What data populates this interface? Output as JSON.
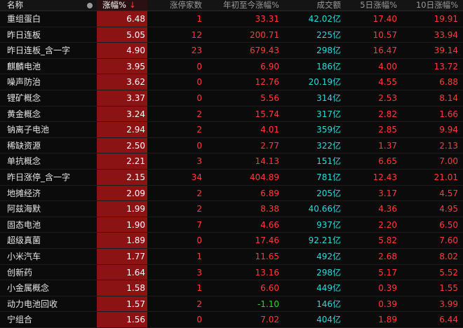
{
  "header": {
    "name": "名称",
    "pct": "涨幅%",
    "pct_sort_arrow": "↓",
    "limit_count": "涨停家数",
    "ytd": "年初至今涨幅%",
    "amount": "成交额",
    "d5": "5日涨幅%",
    "d10": "10日涨幅%"
  },
  "colors": {
    "up": "#ff3b3b",
    "down": "#2fd12f",
    "amount": "#33d6d6",
    "pct_bg": "#8b1313"
  },
  "rows": [
    {
      "name": "重组蛋白",
      "pct": "6.48",
      "limit": "1",
      "ytd": "33.31",
      "amount": "42.02亿",
      "d5": "17.40",
      "d10": "19.91"
    },
    {
      "name": "昨日连板",
      "pct": "5.05",
      "limit": "12",
      "ytd": "200.71",
      "amount": "225亿",
      "d5": "10.57",
      "d10": "33.94"
    },
    {
      "name": "昨日连板_含一字",
      "pct": "4.90",
      "limit": "23",
      "ytd": "679.43",
      "amount": "298亿",
      "d5": "16.47",
      "d10": "39.14"
    },
    {
      "name": "麒麟电池",
      "pct": "3.95",
      "limit": "0",
      "ytd": "6.90",
      "amount": "186亿",
      "d5": "4.00",
      "d10": "13.72"
    },
    {
      "name": "噪声防治",
      "pct": "3.62",
      "limit": "0",
      "ytd": "12.76",
      "amount": "20.19亿",
      "d5": "4.55",
      "d10": "6.88"
    },
    {
      "name": "锂矿概念",
      "pct": "3.37",
      "limit": "0",
      "ytd": "5.56",
      "amount": "314亿",
      "d5": "2.53",
      "d10": "8.14"
    },
    {
      "name": "黄金概念",
      "pct": "3.24",
      "limit": "2",
      "ytd": "15.74",
      "amount": "317亿",
      "d5": "2.82",
      "d10": "1.66"
    },
    {
      "name": "钠离子电池",
      "pct": "2.94",
      "limit": "2",
      "ytd": "4.01",
      "amount": "359亿",
      "d5": "2.85",
      "d10": "9.94"
    },
    {
      "name": "稀缺资源",
      "pct": "2.50",
      "limit": "0",
      "ytd": "2.77",
      "amount": "322亿",
      "d5": "1.37",
      "d10": "2.13"
    },
    {
      "name": "单抗概念",
      "pct": "2.21",
      "limit": "3",
      "ytd": "14.13",
      "amount": "151亿",
      "d5": "6.65",
      "d10": "7.00"
    },
    {
      "name": "昨日涨停_含一字",
      "pct": "2.15",
      "limit": "34",
      "ytd": "404.89",
      "amount": "781亿",
      "d5": "12.43",
      "d10": "21.01"
    },
    {
      "name": "地摊经济",
      "pct": "2.09",
      "limit": "2",
      "ytd": "6.89",
      "amount": "205亿",
      "d5": "3.17",
      "d10": "4.57"
    },
    {
      "name": "阿兹海默",
      "pct": "1.99",
      "limit": "2",
      "ytd": "8.38",
      "amount": "40.66亿",
      "d5": "4.36",
      "d10": "4.95"
    },
    {
      "name": "固态电池",
      "pct": "1.90",
      "limit": "7",
      "ytd": "4.66",
      "amount": "937亿",
      "d5": "2.20",
      "d10": "6.50"
    },
    {
      "name": "超级真菌",
      "pct": "1.89",
      "limit": "0",
      "ytd": "17.46",
      "amount": "92.21亿",
      "d5": "5.82",
      "d10": "7.60"
    },
    {
      "name": "小米汽车",
      "pct": "1.77",
      "limit": "1",
      "ytd": "11.65",
      "amount": "492亿",
      "d5": "2.68",
      "d10": "8.02"
    },
    {
      "name": "创新药",
      "pct": "1.64",
      "limit": "3",
      "ytd": "13.16",
      "amount": "298亿",
      "d5": "5.17",
      "d10": "5.52"
    },
    {
      "name": "小金属概念",
      "pct": "1.58",
      "limit": "1",
      "ytd": "6.60",
      "amount": "449亿",
      "d5": "0.39",
      "d10": "1.55"
    },
    {
      "name": "动力电池回收",
      "pct": "1.57",
      "limit": "2",
      "ytd": "-1.10",
      "amount": "146亿",
      "d5": "0.39",
      "d10": "3.99"
    },
    {
      "name": "宁组合",
      "pct": "1.56",
      "limit": "0",
      "ytd": "7.02",
      "amount": "404亿",
      "d5": "1.89",
      "d10": "6.44"
    }
  ]
}
